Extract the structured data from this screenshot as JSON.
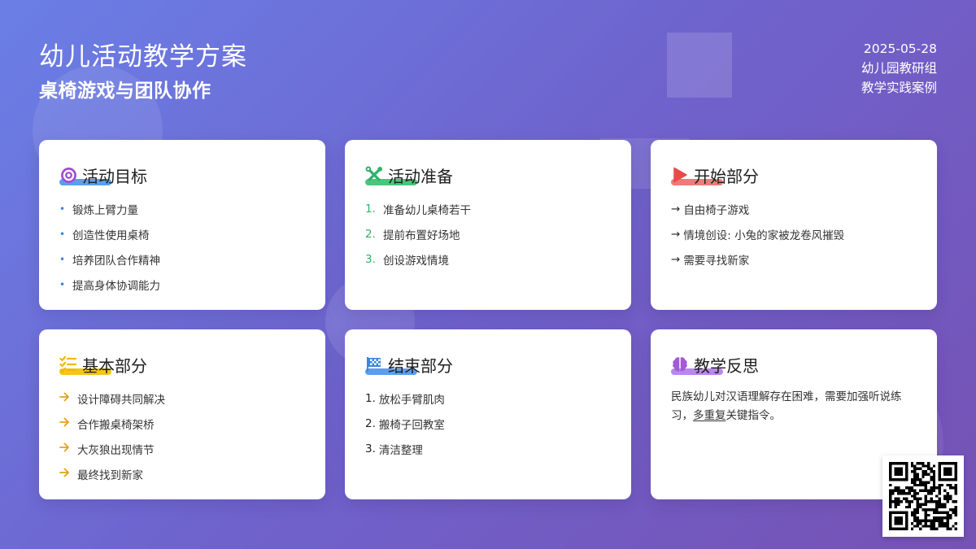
{
  "header": {
    "title": "幼儿活动教学方案",
    "subtitle": "桌椅游戏与团队协作",
    "date": "2025-05-28",
    "group": "幼儿园教研组",
    "case": "教学实践案例"
  },
  "colors": {
    "target_icon": "#a24bd0",
    "prep_icon": "#2fb36a",
    "start_icon": "#e84a4a",
    "basic_icon": "#f2b705",
    "end_icon": "#3d86d8",
    "reflect_icon": "#a35bd9"
  },
  "cards": {
    "goals": {
      "icon": "target-icon",
      "title": "活动目标",
      "items": [
        "锻炼上臂力量",
        "创造性使用桌椅",
        "培养团队合作精神",
        "提高身体协调能力"
      ]
    },
    "prep": {
      "icon": "tools-icon",
      "title": "活动准备",
      "numbers": [
        "1.",
        "2.",
        "3."
      ],
      "items": [
        "准备幼儿桌椅若干",
        "提前布置好场地",
        "创设游戏情境"
      ]
    },
    "start": {
      "icon": "play-icon",
      "title": "开始部分",
      "arrow": "→",
      "items": [
        "自由椅子游戏",
        "情境创设: 小兔的家被龙卷风摧毁",
        "需要寻找新家"
      ]
    },
    "basic": {
      "icon": "checklist-icon",
      "title": "基本部分",
      "items": [
        "设计障碍共同解决",
        "合作搬桌椅架桥",
        "大灰狼出现情节",
        "最终找到新家"
      ]
    },
    "end": {
      "icon": "checkered-flag-icon",
      "title": "结束部分",
      "numbers": [
        "1.",
        "2.",
        "3."
      ],
      "items": [
        "放松手臂肌肉",
        "搬椅子回教室",
        "清洁整理"
      ]
    },
    "reflect": {
      "icon": "brain-icon",
      "title": "教学反思",
      "text_before": "民族幼儿对汉语理解存在困难，需要加强听说练习，",
      "text_emphasis": "多重复",
      "text_after": "关键指令。"
    }
  }
}
